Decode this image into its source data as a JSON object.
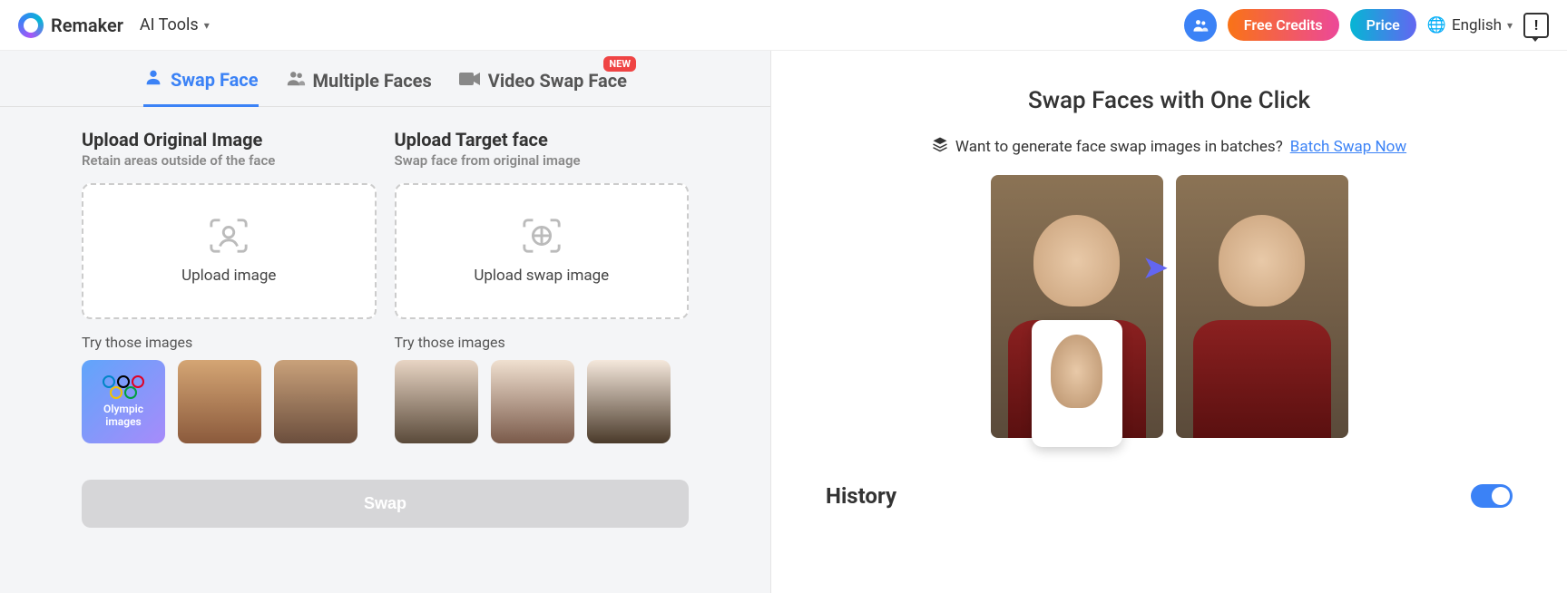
{
  "header": {
    "brand": "Remaker",
    "ai_tools": "AI Tools",
    "free_credits": "Free Credits",
    "price": "Price",
    "language": "English"
  },
  "tabs": {
    "swap_face": "Swap Face",
    "multiple_faces": "Multiple Faces",
    "video_swap": "Video Swap Face",
    "new_badge": "NEW"
  },
  "upload": {
    "original_title": "Upload Original Image",
    "original_sub": "Retain areas outside of the face",
    "original_drop": "Upload image",
    "target_title": "Upload Target face",
    "target_sub": "Swap face from original image",
    "target_drop": "Upload swap image",
    "try_label": "Try those images",
    "olympic_label": "Olympic images",
    "swap_button": "Swap"
  },
  "right": {
    "title": "Swap Faces with One Click",
    "batch_prompt": "Want to generate face swap images in batches?",
    "batch_link": "Batch Swap Now",
    "history": "History"
  }
}
